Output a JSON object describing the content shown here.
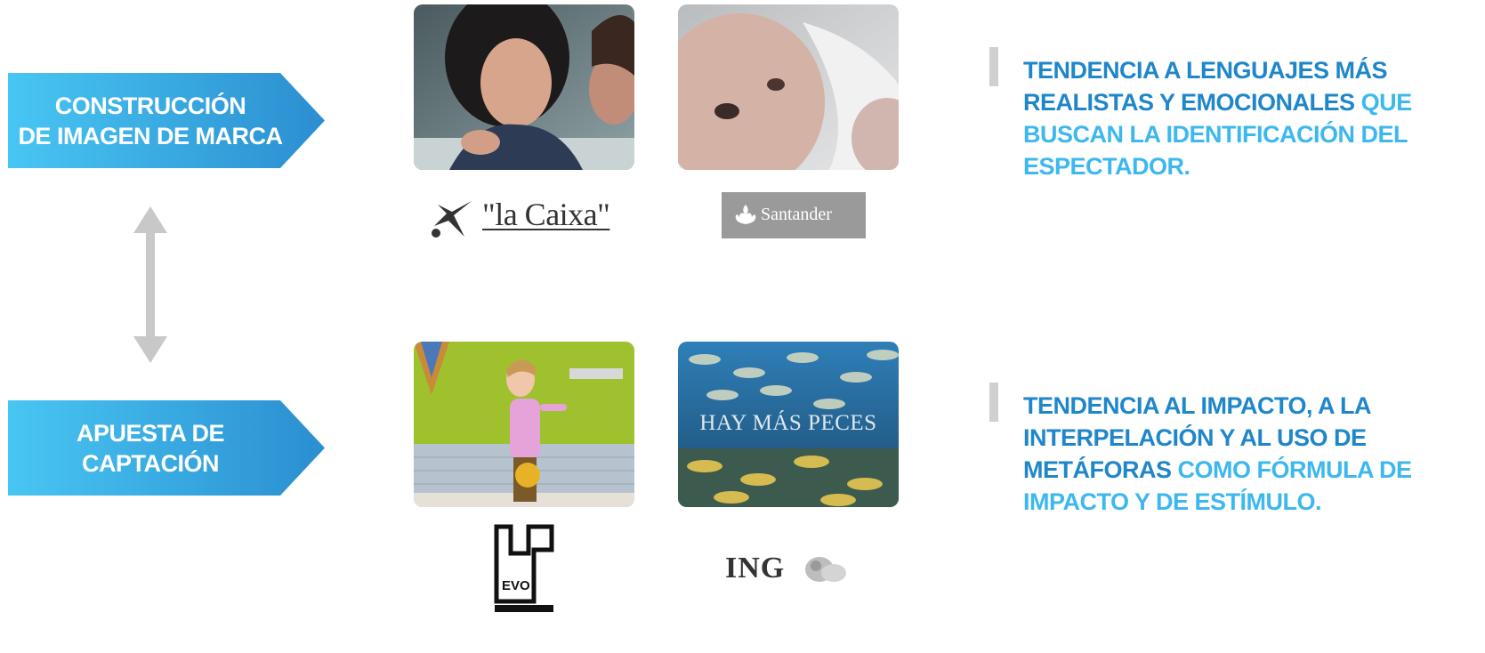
{
  "banners": {
    "top": {
      "line1": "CONSTRUCCIÓN",
      "line2": "DE IMAGEN DE MARCA"
    },
    "bottom": {
      "line1": "APUESTA DE",
      "line2": "CAPTACIÓN"
    }
  },
  "thumbnails": {
    "ing_overlay": "HAY MÁS PECES"
  },
  "logos": {
    "caixa": "\"la Caixa\"",
    "santander": "Santander",
    "evo": "EVO",
    "ing": "ING"
  },
  "statements": {
    "top": {
      "highlight": "TENDENCIA A LENGUAJES MÁS REALISTAS Y EMOCIONALES",
      "rest": " QUE BUSCAN LA IDENTIFICACIÓN DEL ESPECTADOR."
    },
    "bottom": {
      "highlight": "TENDENCIA AL IMPACTO, A LA INTERPELACIÓN Y AL USO DE METÁFORAS",
      "rest": " COMO FÓRMULA DE IMPACTO Y DE ESTÍMULO."
    }
  },
  "colors": {
    "banner_gradient_start": "#48c6f3",
    "banner_gradient_end": "#2b8ed0",
    "text_dark_blue": "#1f87c9",
    "text_light_blue": "#3db8ee",
    "connector_gray": "#c8c8c8"
  }
}
